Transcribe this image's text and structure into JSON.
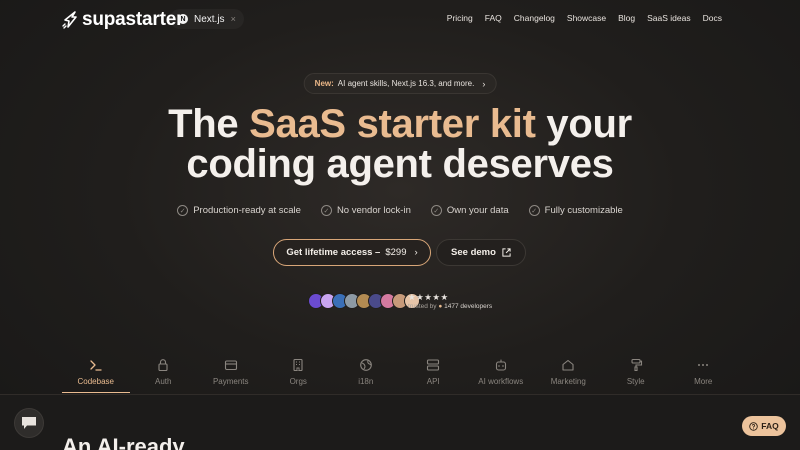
{
  "brand": {
    "name": "supastarter"
  },
  "framework_chip": {
    "badge": "N",
    "label": "Next.js",
    "close": "×"
  },
  "nav": {
    "items": [
      "Pricing",
      "FAQ",
      "Changelog",
      "Showcase",
      "Blog",
      "SaaS ideas",
      "Docs"
    ]
  },
  "announcement": {
    "tag": "New:",
    "text": "AI agent skills, Next.js 16.3, and more.",
    "chevron": "›"
  },
  "hero": {
    "line1_pre": "The ",
    "line1_accent": "SaaS starter kit",
    "line1_post": " your",
    "line2": "coding agent deserves"
  },
  "features": [
    "Production-ready at scale",
    "No vendor lock-in",
    "Own your data",
    "Fully customizable"
  ],
  "cta": {
    "primary_label": "Get lifetime access –",
    "primary_price": "$299",
    "primary_chevron": "›",
    "secondary_label": "See demo"
  },
  "social_proof": {
    "stars": "★★★★★",
    "trusted_prefix": "trusted by",
    "dot": "●",
    "count": "1477 developers",
    "avatar_colors": [
      "#6b4bd1",
      "#c9a5f0",
      "#3a6fb7",
      "#8d9aa5",
      "#b38b52",
      "#4a4a8a",
      "#d47aa0",
      "#c79a7a",
      "#e6c4a8"
    ]
  },
  "tabs": [
    {
      "label": "Codebase",
      "icon": "terminal-icon",
      "active": true
    },
    {
      "label": "Auth",
      "icon": "lock-icon",
      "active": false
    },
    {
      "label": "Payments",
      "icon": "wallet-icon",
      "active": false
    },
    {
      "label": "Orgs",
      "icon": "building-icon",
      "active": false
    },
    {
      "label": "i18n",
      "icon": "globe-icon",
      "active": false
    },
    {
      "label": "API",
      "icon": "server-icon",
      "active": false
    },
    {
      "label": "AI workflows",
      "icon": "robot-icon",
      "active": false
    },
    {
      "label": "Marketing",
      "icon": "home-icon",
      "active": false
    },
    {
      "label": "Style",
      "icon": "paint-roller-icon",
      "active": false
    },
    {
      "label": "More",
      "icon": "more-dots-icon",
      "active": false
    }
  ],
  "section": {
    "title": "An AI-ready"
  },
  "faq_button": {
    "label": "FAQ"
  },
  "colors": {
    "accent": "#e9bb90",
    "background": "#1f1d1b",
    "faq_button": "#ecc39c"
  }
}
